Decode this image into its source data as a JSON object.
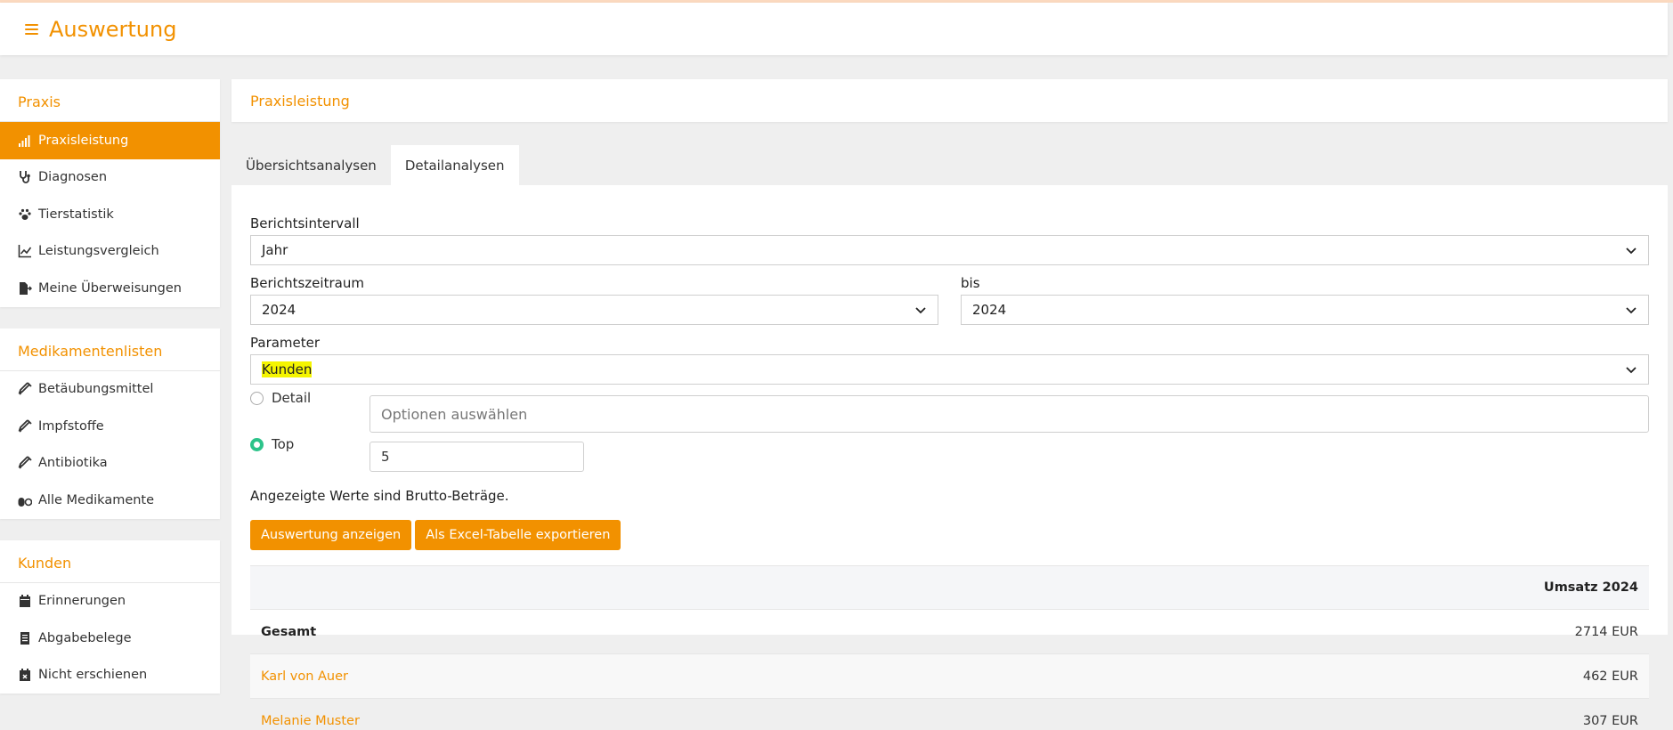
{
  "header": {
    "title": "Auswertung",
    "menu_icon": "hamburger-icon"
  },
  "sidebar": {
    "sections": [
      {
        "title": "Praxis",
        "items": [
          {
            "label": "Praxisleistung",
            "icon": "bar-chart-icon",
            "active": true
          },
          {
            "label": "Diagnosen",
            "icon": "stethoscope-icon",
            "active": false
          },
          {
            "label": "Tierstatistik",
            "icon": "paw-icon",
            "active": false
          },
          {
            "label": "Leistungsvergleich",
            "icon": "line-chart-icon",
            "active": false
          },
          {
            "label": "Meine Überweisungen",
            "icon": "file-export-icon",
            "active": false
          }
        ]
      },
      {
        "title": "Medikamentenlisten",
        "items": [
          {
            "label": "Betäubungsmittel",
            "icon": "syringe-icon"
          },
          {
            "label": "Impfstoffe",
            "icon": "syringe-icon"
          },
          {
            "label": "Antibiotika",
            "icon": "syringe-icon"
          },
          {
            "label": "Alle Medikamente",
            "icon": "pills-icon"
          }
        ]
      },
      {
        "title": "Kunden",
        "items": [
          {
            "label": "Erinnerungen",
            "icon": "calendar-icon"
          },
          {
            "label": "Abgabebelege",
            "icon": "receipt-icon"
          },
          {
            "label": "Nicht erschienen",
            "icon": "calendar-x-icon"
          }
        ]
      }
    ]
  },
  "main": {
    "panel_title": "Praxisleistung",
    "tabs": [
      {
        "label": "Übersichtsanalysen",
        "active": false
      },
      {
        "label": "Detailanalysen",
        "active": true
      }
    ],
    "form": {
      "interval_label": "Berichtsintervall",
      "interval_value": "Jahr",
      "period_label": "Berichtszeitraum",
      "period_from": "2024",
      "period_to_label": "bis",
      "period_to": "2024",
      "parameter_label": "Parameter",
      "parameter_value": "Kunden",
      "radio_detail": "Detail",
      "radio_top": "Top",
      "selected_radio": "Top",
      "options_placeholder": "Optionen auswählen",
      "top_value": "5",
      "note": "Angezeigte Werte sind Brutto-Beträge.",
      "btn_show": "Auswertung anzeigen",
      "btn_export": "Als Excel-Tabelle exportieren"
    },
    "table": {
      "column_header": "Umsatz 2024",
      "rows": [
        {
          "name": "Gesamt",
          "amount": "2714 EUR"
        },
        {
          "name": "Karl von Auer",
          "amount": "462 EUR"
        },
        {
          "name": "Melanie Muster",
          "amount": "307 EUR"
        }
      ]
    }
  },
  "colors": {
    "accent": "#f29100",
    "radio_on": "#2cc38a",
    "highlight": "#f5f500"
  }
}
